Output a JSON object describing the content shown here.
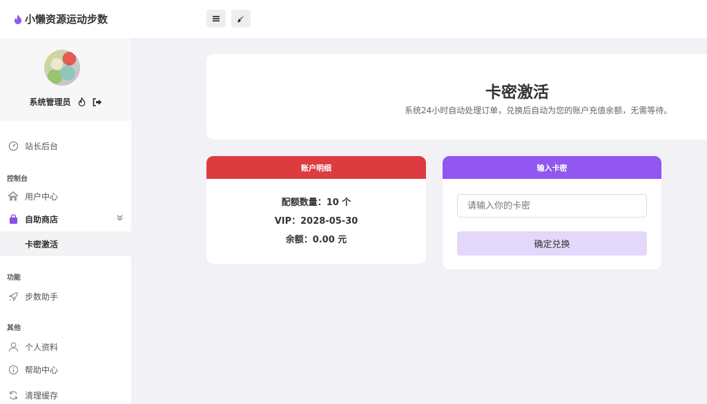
{
  "app": {
    "title": "小懒资源运动步数",
    "accent": "#9157f0"
  },
  "toolbar": {
    "menu_icon": "menu-icon",
    "theme_icon": "brush-icon"
  },
  "profile": {
    "name": "系统管理员",
    "icons": [
      "flame-icon",
      "logout-icon"
    ]
  },
  "sidebar": {
    "dashboard": "站长后台",
    "section_console": "控制台",
    "user_center": "用户中心",
    "shop": "自助商店",
    "shop_sub": "卡密激活",
    "section_function": "功能",
    "step_helper": "步数助手",
    "section_other": "其他",
    "profile": "个人资料",
    "help": "帮助中心",
    "clear_cache": "清理缓存"
  },
  "hero": {
    "title": "卡密激活",
    "subtitle": "系统24小时自动处理订单，兑换后自动为您的账户充值余额，无需等待。"
  },
  "account": {
    "header": "账户明细",
    "quota": "配额数量：10 个",
    "vip": "VIP：2028-05-30",
    "balance": "余额：0.00 元",
    "header_color": "#dc3c40"
  },
  "redeem": {
    "header": "输入卡密",
    "placeholder": "请输入你的卡密",
    "button": "确定兑换",
    "header_color": "#9157f0"
  }
}
